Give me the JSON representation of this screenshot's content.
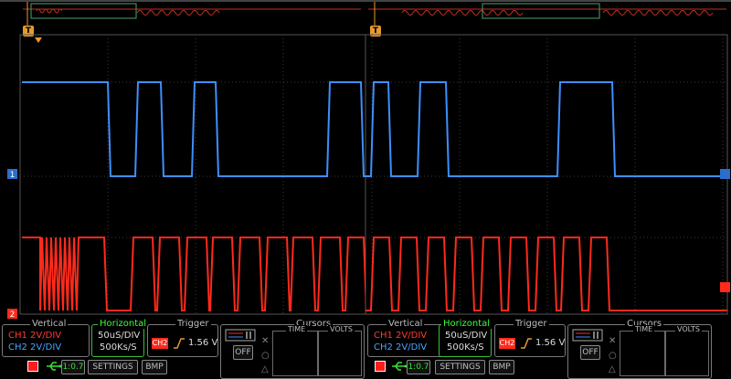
{
  "colors": {
    "ch1": "#3d8fff",
    "ch2": "#ff2a1c",
    "grid": "#3a3a3a",
    "trigger": "#e69a2e",
    "green": "#38e038"
  },
  "panes": [
    {
      "vertical": {
        "title": "Vertical",
        "ch1": "CH1 2V/DIV",
        "ch2": "CH2 2V/DIV"
      },
      "horizontal": {
        "title": "Horizontal",
        "timebase": "50uS/DIV",
        "samplerate": "500Ks/S"
      },
      "trigger": {
        "title": "Trigger",
        "source": "CH2",
        "level": "1.56 V"
      },
      "cursors": {
        "title": "Cursors",
        "time": "TIME",
        "volts": "VOLTS",
        "off": "OFF"
      },
      "buttons": {
        "zoom": "1:0.7",
        "settings": "SETTINGS",
        "bmp": "BMP"
      },
      "marker": "T"
    },
    {
      "vertical": {
        "title": "Vertical",
        "ch1": "CH1 2V/DIV",
        "ch2": "CH2 2V/DIV"
      },
      "horizontal": {
        "title": "Horizontal",
        "timebase": "50uS/DIV",
        "samplerate": "500Ks/S"
      },
      "trigger": {
        "title": "Trigger",
        "source": "CH2",
        "level": "1.56 V"
      },
      "cursors": {
        "title": "Cursors",
        "time": "TIME",
        "volts": "VOLTS",
        "off": "OFF"
      },
      "buttons": {
        "zoom": "1:0.7",
        "settings": "SETTINGS",
        "bmp": "BMP"
      },
      "marker": "T"
    }
  ],
  "channel_markers": {
    "ch1": "1",
    "ch2": "2"
  }
}
